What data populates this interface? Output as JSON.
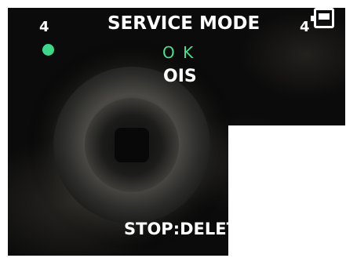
{
  "screen": {
    "title": "SERVICE MODE",
    "mode_number_left": "4",
    "mode_number_right": "4",
    "status": "O K",
    "test_name": "OIS",
    "bottom_label": "STOP:DELET"
  },
  "colors": {
    "status_green": "#4fdc8f",
    "indicator_green": "#3fd68b",
    "text": "#ffffff",
    "background": "#0b0b0b"
  },
  "icons": {
    "battery": "battery-icon",
    "status_indicator": "green-dot-icon"
  }
}
